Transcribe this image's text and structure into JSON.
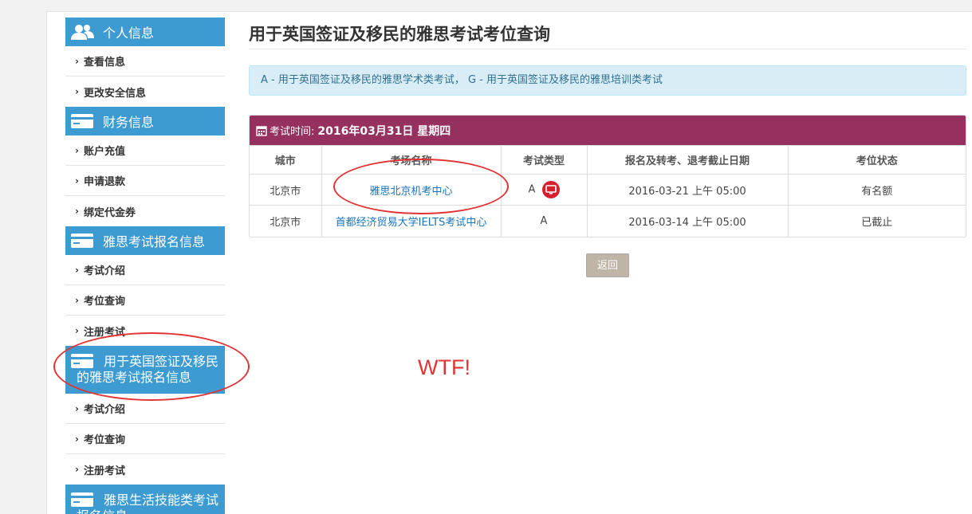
{
  "sidebar": {
    "sections": [
      {
        "title": "个人信息",
        "icon": "users-icon",
        "items": [
          "查看信息",
          "更改安全信息"
        ]
      },
      {
        "title": "财务信息",
        "icon": "card-icon",
        "items": [
          "账户充值",
          "申请退款",
          "绑定代金券"
        ]
      },
      {
        "title": "雅思考试报名信息",
        "icon": "card-icon",
        "items": [
          "考试介绍",
          "考位查询",
          "注册考试"
        ]
      },
      {
        "title": "用于英国签证及移民的雅思考试报名信息",
        "icon": "card-icon",
        "items": [
          "考试介绍",
          "考位查询",
          "注册考试"
        ]
      },
      {
        "title": "雅思生活技能类考试报名信息",
        "icon": "card-icon",
        "items": []
      }
    ],
    "chevron": "›"
  },
  "main": {
    "title": "用于英国签证及移民的雅思考试考位查询",
    "info": "A - 用于英国签证及移民的雅思学术类考试， G - 用于英国签证及移民的雅思培训类考试",
    "panel": {
      "date_label": "考试时间:",
      "date_value": "2016年03月31日 星期四"
    },
    "table": {
      "headers": [
        "城市",
        "考场名称",
        "考试类型",
        "报名及转考、退考截止日期",
        "考位状态"
      ],
      "rows": [
        {
          "city": "北京市",
          "venue": "雅思北京机考中心",
          "type": "A",
          "computer": true,
          "deadline": "2016-03-21 上午 05:00",
          "status": "有名额"
        },
        {
          "city": "北京市",
          "venue": "首都经济贸易大学IELTS考试中心",
          "type": "A",
          "computer": false,
          "deadline": "2016-03-14 上午 05:00",
          "status": "已截止"
        }
      ]
    },
    "back_button": "返回"
  },
  "annotation": {
    "text": "WTF!",
    "color": "#e23434"
  },
  "colors": {
    "sidebar_header": "#3d9bd1",
    "panel_header": "#96305f",
    "info_bg": "#d9edf7",
    "button_bg": "#bfb5a6"
  }
}
